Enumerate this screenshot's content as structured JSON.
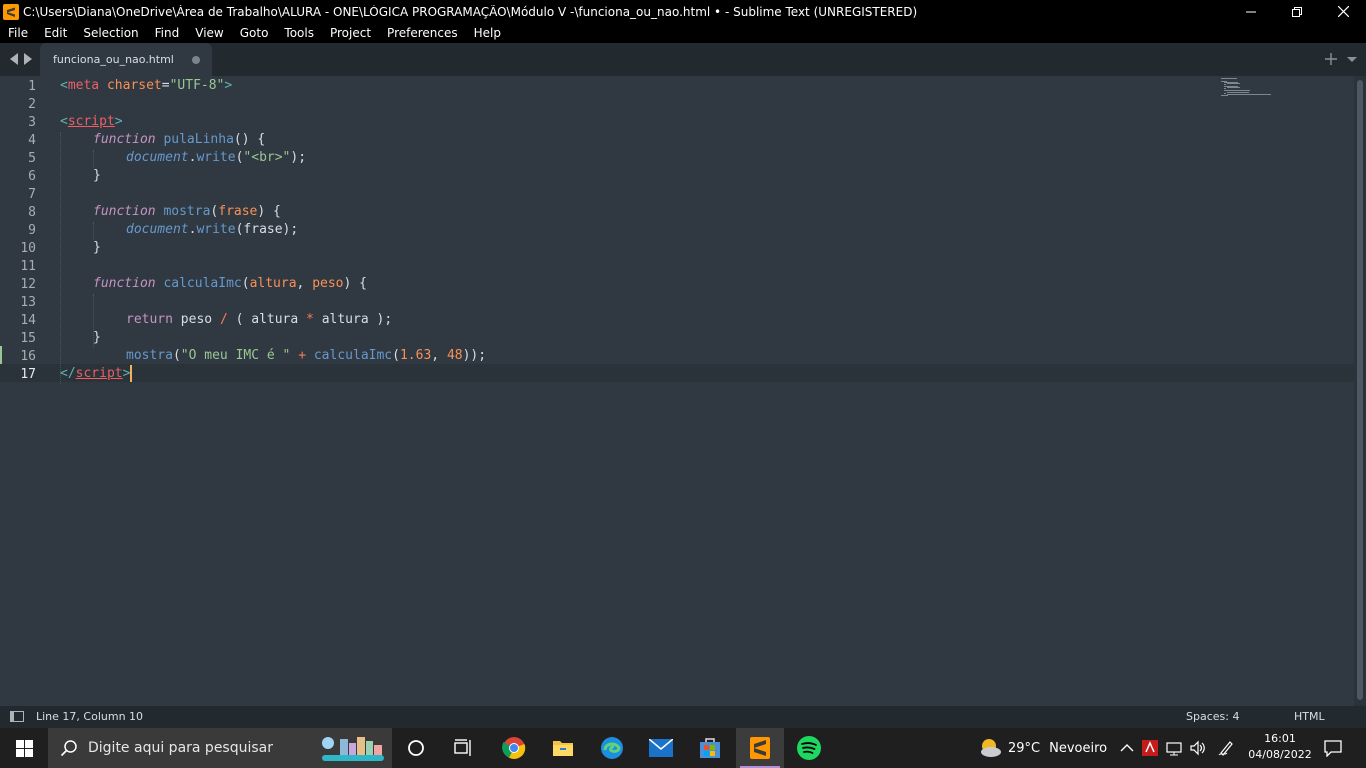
{
  "window": {
    "title": "C:\\Users\\Diana\\OneDrive\\Área de Trabalho\\ALURA - ONE\\LÓGICA PROGRAMAÇÃO\\Módulo V -\\funciona_ou_nao.html • - Sublime Text (UNREGISTERED)",
    "controls": [
      "minimize-icon",
      "restore-icon",
      "close-icon"
    ]
  },
  "menu": [
    "File",
    "Edit",
    "Selection",
    "Find",
    "View",
    "Goto",
    "Tools",
    "Project",
    "Preferences",
    "Help"
  ],
  "tab": {
    "label": "funciona_ou_nao.html",
    "dirty": true
  },
  "editor": {
    "line_numbers": [
      "1",
      "2",
      "3",
      "4",
      "5",
      "6",
      "7",
      "8",
      "9",
      "10",
      "11",
      "12",
      "13",
      "14",
      "15",
      "16",
      "17"
    ],
    "active_line": 17,
    "modified_line": 16,
    "lines": {
      "l1": [
        "<",
        "meta",
        " ",
        "charset",
        "=",
        "\"UTF-8\"",
        ">"
      ],
      "l3": [
        "<",
        "script",
        ">"
      ],
      "l4": [
        "function",
        " ",
        "pulaLinha",
        "() {"
      ],
      "l5": [
        "document",
        ".",
        "write",
        "(",
        "\"<br>\"",
        ");"
      ],
      "l6": [
        "}"
      ],
      "l8": [
        "function",
        " ",
        "mostra",
        "(",
        "frase",
        ") {"
      ],
      "l9": [
        "document",
        ".",
        "write",
        "(frase);"
      ],
      "l10": [
        "}"
      ],
      "l12": [
        "function",
        " ",
        "calculaImc",
        "(",
        "altura",
        ", ",
        "peso",
        ") {"
      ],
      "l14": [
        "return",
        " peso ",
        "/",
        " ( altura ",
        "*",
        " altura );"
      ],
      "l15": [
        "}"
      ],
      "l16": [
        "mostra",
        "(",
        "\"O meu IMC é \"",
        " ",
        "+",
        " ",
        "calculaImc",
        "(",
        "1.63",
        ", ",
        "48",
        "));"
      ],
      "l17": [
        "</",
        "script",
        ">"
      ]
    }
  },
  "status": {
    "position": "Line 17, Column 10",
    "indent": "Spaces: 4",
    "syntax": "HTML"
  },
  "taskbar": {
    "search_placeholder": "Digite aqui para pesquisar",
    "apps": [
      "cortana-icon",
      "task-view-icon",
      "chrome-icon",
      "file-explorer-icon",
      "edge-icon",
      "mail-icon",
      "store-icon",
      "sublime-text-icon",
      "spotify-icon"
    ],
    "weather": {
      "temp": "29°C",
      "condition": "Nevoeiro"
    },
    "clock": {
      "time": "16:01",
      "date": "04/08/2022"
    }
  }
}
